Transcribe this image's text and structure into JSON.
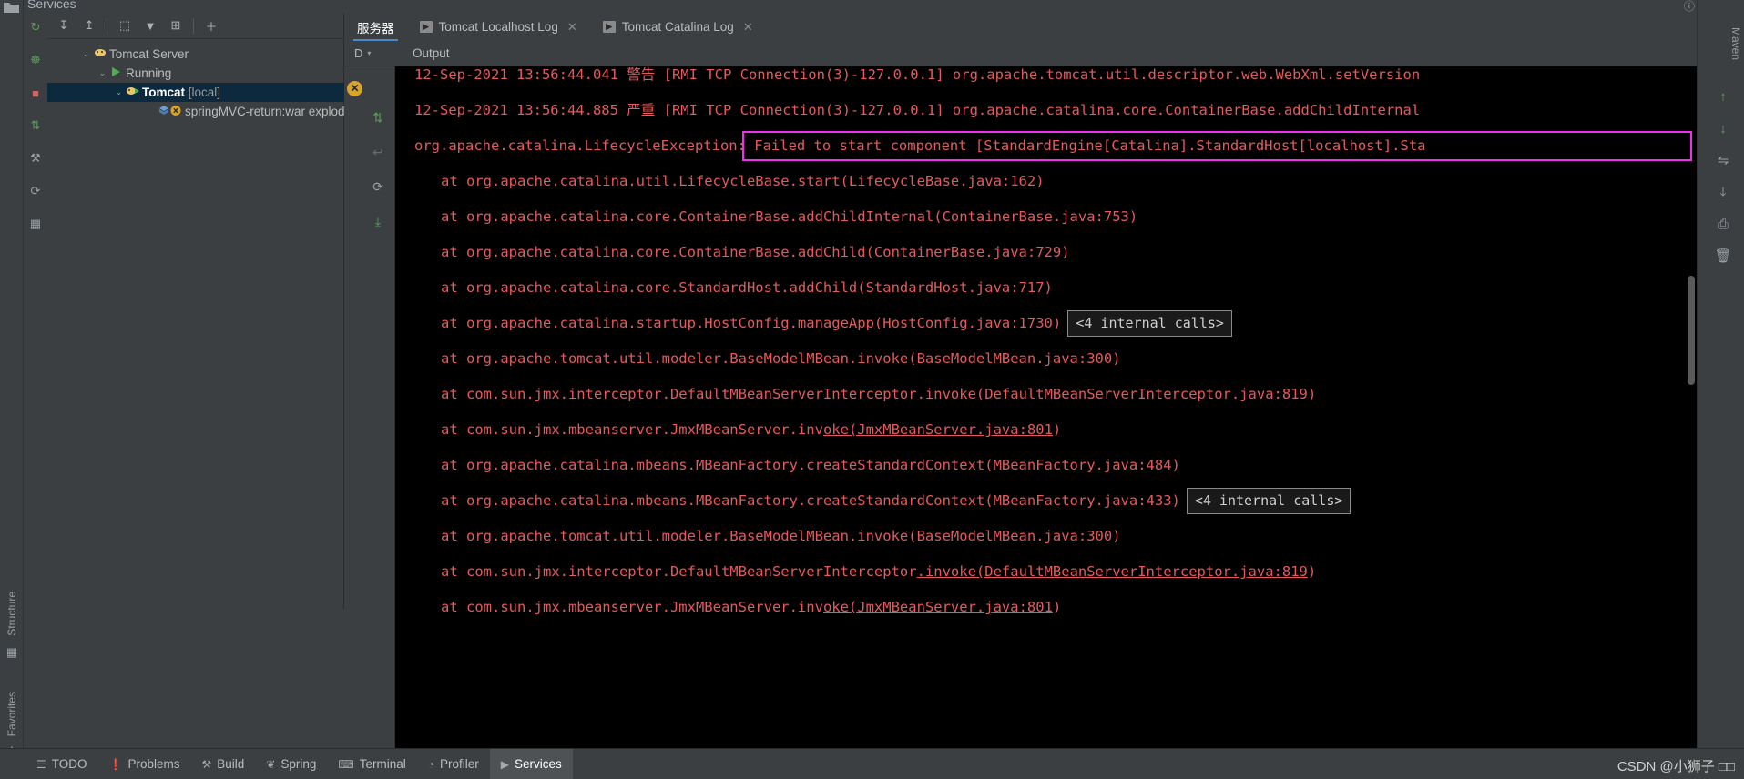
{
  "window": {
    "panel_title": "Services",
    "top_right_icons": [
      "help-icon",
      "settings-icon",
      "minimize-icon"
    ]
  },
  "left_rail": {
    "top_icon": "project-folder-icon",
    "labels": [
      {
        "name": "structure",
        "text": "Structure"
      },
      {
        "name": "favorites",
        "text": "Favorites"
      }
    ],
    "bottom_icons": [
      "structure-icon",
      "star-icon"
    ]
  },
  "services_rail": {
    "icons": [
      {
        "name": "rerun-icon",
        "glyph": "↻",
        "color": "#5a9e5a"
      },
      {
        "name": "debug-icon",
        "glyph": "☸",
        "color": "#5a9e5a"
      },
      {
        "name": "stop-icon",
        "glyph": "■",
        "color": "#cc6666"
      },
      {
        "name": "deploy-icon",
        "glyph": "⇅",
        "color": "#5a9e5a"
      },
      {
        "name": "settings-wrench-icon",
        "glyph": "⚒",
        "color": "#9aa0a6"
      },
      {
        "name": "refresh-icon",
        "glyph": "⟳",
        "color": "#9aa0a6"
      },
      {
        "name": "grid-icon",
        "glyph": "▦",
        "color": "#9aa0a6"
      }
    ]
  },
  "tree_toolbar": {
    "buttons": [
      {
        "name": "expand-all-button",
        "glyph": "↧"
      },
      {
        "name": "collapse-all-button",
        "glyph": "↥"
      },
      {
        "name": "group-by-button",
        "glyph": "⬚"
      },
      {
        "name": "filter-button",
        "glyph": "▼"
      },
      {
        "name": "add-tab-button",
        "glyph": "⊞"
      },
      {
        "name": "add-service-button",
        "glyph": "＋"
      }
    ]
  },
  "services_tree": {
    "nodes": [
      {
        "name": "tomcat-server-node",
        "label": "Tomcat Server",
        "bold": "",
        "dim": "",
        "indent": 62,
        "twist": "⌄",
        "icon": "tomcat-icon",
        "selected": false
      },
      {
        "name": "running-node",
        "label": "Running",
        "bold": "",
        "dim": "",
        "indent": 80,
        "twist": "⌄",
        "icon": "run-green-triangle-icon",
        "selected": false
      },
      {
        "name": "tomcat-local-node",
        "label": "",
        "bold": "Tomcat",
        "dim": "[local]",
        "indent": 98,
        "twist": "⌄",
        "icon": "tomcat-running-icon",
        "selected": true
      },
      {
        "name": "artifact-node",
        "label": "springMVC-return:war exploded",
        "bold": "",
        "dim": "",
        "indent": 134,
        "twist": "",
        "icon": "artifact-error-icon",
        "selected": false
      }
    ]
  },
  "tabs": [
    {
      "name": "tab-server",
      "label": "服务器",
      "active": true,
      "has_run_icon": false,
      "closable": false
    },
    {
      "name": "tab-tomcat-localhost-log",
      "label": "Tomcat Localhost Log",
      "active": false,
      "has_run_icon": true,
      "closable": true
    },
    {
      "name": "tab-tomcat-catalina-log",
      "label": "Tomcat Catalina Log",
      "active": false,
      "has_run_icon": true,
      "closable": true
    }
  ],
  "output_header": {
    "dropdown_label": "D",
    "dropdown_caret": "▾",
    "output_label": "Output"
  },
  "log_gutter": {
    "stop_badge": "✕",
    "icons": [
      {
        "name": "scroll-to-end-icon",
        "glyph": "⇅",
        "color": "#5a9e5a"
      },
      {
        "name": "soft-wrap-icon",
        "glyph": "↩",
        "color": "#6b6b6b"
      },
      {
        "name": "restart-icon",
        "glyph": "⟳",
        "color": "#9aa0a6"
      },
      {
        "name": "export-icon",
        "glyph": "⤓",
        "color": "#5a9e5a"
      }
    ]
  },
  "log": {
    "lines": [
      {
        "name": "log-line-warn-1",
        "text": "12-Sep-2021 13:56:44.041 警告 [RMI TCP Connection(3)-127.0.0.1] org.apache.tomcat.util.descriptor.web.WebXml.setVersion",
        "indent": 21,
        "fold": false,
        "chip": ""
      },
      {
        "name": "log-line-severe-1",
        "text": "12-Sep-2021 13:56:44.885 严重 [RMI TCP Connection(3)-127.0.0.1] org.apache.catalina.core.ContainerBase.addChildInternal",
        "indent": 21,
        "fold": false,
        "chip": ""
      },
      {
        "name": "log-line-exception",
        "text": "org.apache.catalina.LifecycleException: Failed to start component [StandardEngine[Catalina].StandardHost[localhost].Sta",
        "indent": 21,
        "fold": false,
        "chip": ""
      },
      {
        "name": "log-line-stack-1",
        "text": "at org.apache.catalina.util.LifecycleBase.start(LifecycleBase.java:162)",
        "indent": 50,
        "fold": false,
        "chip": ""
      },
      {
        "name": "log-line-stack-2",
        "text": "at org.apache.catalina.core.ContainerBase.addChildInternal(ContainerBase.java:753)",
        "indent": 50,
        "fold": false,
        "chip": ""
      },
      {
        "name": "log-line-stack-3",
        "text": "at org.apache.catalina.core.ContainerBase.addChild(ContainerBase.java:729)",
        "indent": 50,
        "fold": false,
        "chip": ""
      },
      {
        "name": "log-line-stack-4",
        "text": "at org.apache.catalina.core.StandardHost.addChild(StandardHost.java:717)",
        "indent": 50,
        "fold": false,
        "chip": ""
      },
      {
        "name": "log-line-stack-5",
        "text": "at org.apache.catalina.startup.HostConfig.manageApp(HostConfig.java:1730)",
        "indent": 50,
        "fold": true,
        "chip": "<4 internal calls>"
      },
      {
        "name": "log-line-stack-6",
        "text": "at org.apache.tomcat.util.modeler.BaseModelMBean.invoke(BaseModelMBean.java:300)",
        "indent": 50,
        "fold": false,
        "chip": ""
      },
      {
        "name": "log-line-stack-7",
        "text": "at com.sun.jmx.interceptor.DefaultMBeanServerInterceptor.invoke(DefaultMBeanServerInterceptor.java:819)",
        "indent": 50,
        "fold": false,
        "chip": "",
        "link_from": 56
      },
      {
        "name": "log-line-stack-8",
        "text": "at com.sun.jmx.mbeanserver.JmxMBeanServer.invoke(JmxMBeanServer.java:801)",
        "indent": 50,
        "fold": false,
        "chip": "",
        "link_from": 45
      },
      {
        "name": "log-line-stack-9",
        "text": "at org.apache.catalina.mbeans.MBeanFactory.createStandardContext(MBeanFactory.java:484)",
        "indent": 50,
        "fold": false,
        "chip": ""
      },
      {
        "name": "log-line-stack-10",
        "text": "at org.apache.catalina.mbeans.MBeanFactory.createStandardContext(MBeanFactory.java:433)",
        "indent": 50,
        "fold": true,
        "chip": "<4 internal calls>"
      },
      {
        "name": "log-line-stack-11",
        "text": "at org.apache.tomcat.util.modeler.BaseModelMBean.invoke(BaseModelMBean.java:300)",
        "indent": 50,
        "fold": false,
        "chip": ""
      },
      {
        "name": "log-line-stack-12",
        "text": "at com.sun.jmx.interceptor.DefaultMBeanServerInterceptor.invoke(DefaultMBeanServerInterceptor.java:819)",
        "indent": 50,
        "fold": false,
        "chip": "",
        "link_from": 56
      },
      {
        "name": "log-line-stack-13",
        "text": "at com.sun.jmx.mbeanserver.JmxMBeanServer.invoke(JmxMBeanServer.java:801)",
        "indent": 50,
        "fold": false,
        "chip": "",
        "link_from": 45
      }
    ],
    "highlight_box_color": "#ef2fef",
    "text_color": "#e35b5b"
  },
  "right_rail": {
    "labels": [
      {
        "name": "maven-label",
        "text": "Maven"
      }
    ],
    "icons": [
      {
        "name": "scroll-up-icon",
        "glyph": "↑",
        "color": "#5a9e5a"
      },
      {
        "name": "scroll-down-icon",
        "glyph": "↓",
        "color": "#5a9e5a"
      },
      {
        "name": "wrap-icon",
        "glyph": "⇋",
        "color": "#9aa0a6"
      },
      {
        "name": "download-icon",
        "glyph": "⤓",
        "color": "#9aa0a6"
      },
      {
        "name": "print-icon",
        "glyph": "⎙",
        "color": "#9aa0a6"
      },
      {
        "name": "trash-icon",
        "glyph": "🗑",
        "color": "#9aa0a6"
      }
    ]
  },
  "status_bar": {
    "buttons": [
      {
        "name": "status-todo",
        "glyph": "☰",
        "label": "TODO",
        "active": false
      },
      {
        "name": "status-problems",
        "glyph": "❗",
        "label": "Problems",
        "active": false
      },
      {
        "name": "status-build",
        "glyph": "⚒",
        "label": "Build",
        "active": false
      },
      {
        "name": "status-spring",
        "glyph": "❦",
        "label": "Spring",
        "active": false
      },
      {
        "name": "status-terminal",
        "glyph": "⌨",
        "label": "Terminal",
        "active": false
      },
      {
        "name": "status-profiler",
        "glyph": "◔",
        "label": "Profiler",
        "active": false
      },
      {
        "name": "status-services",
        "glyph": "▶",
        "label": "Services",
        "active": true
      }
    ],
    "watermark": "CSDN @小狮子 □□"
  }
}
